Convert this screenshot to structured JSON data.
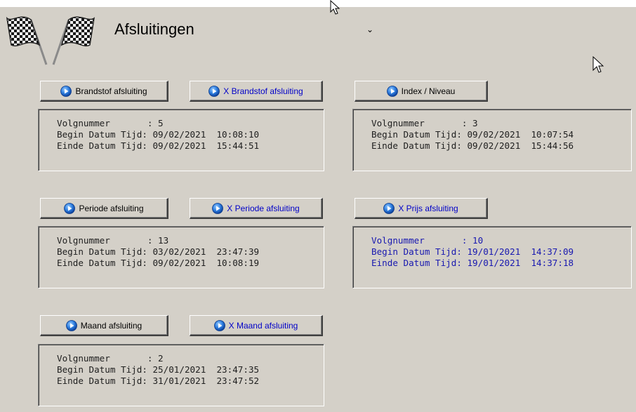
{
  "window": {
    "title": "Afsluitingen"
  },
  "colors": {
    "background": "#d4d0c8",
    "blue_text": "#0000c8",
    "black_text": "#000000"
  },
  "icons": {
    "logo": "checkered-flags-icon",
    "button_icon": "blue-play-circle-icon",
    "pointer": "mouse-pointer-icon"
  },
  "sections": {
    "brandstof": {
      "button": "Brandstof afsluiting",
      "x_button": "X Brandstof afsluiting",
      "lines": [
        "Volgnummer       : 5",
        "Begin Datum Tijd: 09/02/2021  10:08:10",
        "Einde Datum Tijd: 09/02/2021  15:44:51"
      ]
    },
    "index": {
      "button": "Index / Niveau",
      "lines": [
        "Volgnummer       : 3",
        "Begin Datum Tijd: 09/02/2021  10:07:54",
        "Einde Datum Tijd: 09/02/2021  15:44:56"
      ]
    },
    "periode": {
      "button": "Periode afsluiting",
      "x_button": "X Periode afsluiting",
      "lines": [
        "Volgnummer       : 13",
        "Begin Datum Tijd: 03/02/2021  23:47:39",
        "Einde Datum Tijd: 09/02/2021  10:08:19"
      ]
    },
    "prijs": {
      "x_button": "X Prijs afsluiting",
      "lines": [
        "Volgnummer       : 10",
        "Begin Datum Tijd: 19/01/2021  14:37:09",
        "Einde Datum Tijd: 19/01/2021  14:37:18"
      ]
    },
    "maand": {
      "button": "Maand afsluiting",
      "x_button": "X Maand afsluiting",
      "lines": [
        "Volgnummer       : 2",
        "Begin Datum Tijd: 25/01/2021  23:47:35",
        "Einde Datum Tijd: 31/01/2021  23:47:52"
      ]
    }
  }
}
